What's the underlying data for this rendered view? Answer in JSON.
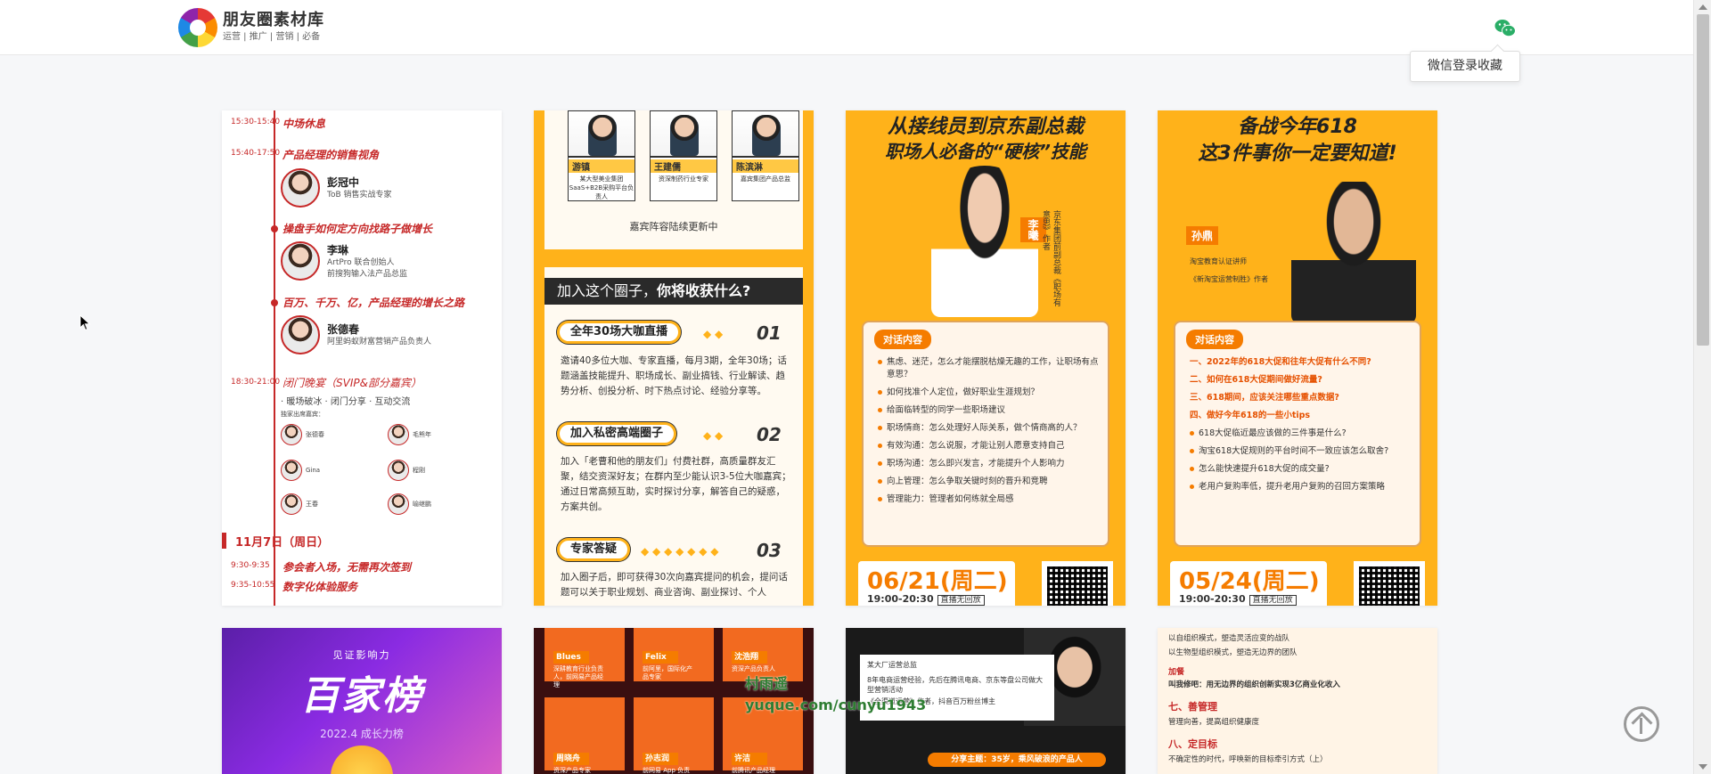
{
  "header": {
    "brand_title": "朋友圈素材库",
    "brand_sub": "运营 | 推广 | 营销 | 必备",
    "login_tip": "微信登录收藏"
  },
  "card1": {
    "items": [
      {
        "time": "15:30-15:40",
        "title": "中场休息"
      },
      {
        "time": "15:40-17:50",
        "title": "产品经理的销售视角"
      },
      {
        "time": "",
        "title": "操盘手如何定方向找路子做增长"
      },
      {
        "time": "",
        "title": "百万、千万、亿，产品经理的增长之路"
      },
      {
        "time": "18:30-21:00",
        "title": "闭门晚宴（SVIP&部分嘉宾）"
      }
    ],
    "speakers": [
      {
        "name": "彭冠中",
        "desc1": "ToB 销售实战专家",
        "desc2": ""
      },
      {
        "name": "李琳",
        "desc1": "ArtPro 联合创始人",
        "desc2": "前搜狗输入法产品总监"
      },
      {
        "name": "张德春",
        "desc1": "阿里蚂蚁财富营销产品负责人",
        "desc2": ""
      }
    ],
    "dinner_tags": "· 暖场破冰 · 闭门分享 · 互动交流",
    "guests_label": "独家出席嘉宾：",
    "mini": [
      {
        "name": "张德春"
      },
      {
        "name": "毛熊年"
      },
      {
        "name": "Gina"
      },
      {
        "name": "程刚"
      },
      {
        "name": "王春"
      },
      {
        "name": "喻继鹏"
      }
    ],
    "date": "11月7日（周日）",
    "items2": [
      {
        "time": "9:30-9:35",
        "title": "参会者入场，无需再次签到"
      },
      {
        "time": "9:35-10:55",
        "title": "数字化体验服务"
      }
    ]
  },
  "card2": {
    "heads": [
      {
        "name": "游镇",
        "desc": "某大型美业集团 SaaS+B2B采购平台负责人"
      },
      {
        "name": "王建儒",
        "desc": "资深制药行业专家"
      },
      {
        "name": "陈滨淋",
        "desc": "嘉宾集团产品总监"
      }
    ],
    "update": "嘉宾阵容陆续更新中",
    "banner_a": "加入这个圈子，",
    "banner_b": "你将收获什么?",
    "blocks": [
      {
        "pill": "全年30场大咖直播",
        "num": "01",
        "text": "邀请40多位大咖、专家直播，每月3期，全年30场；话题涵盖技能提升、职场成长、副业搞钱、行业解读、趋势分析、创投分析、时下热点讨论、经验分享等。"
      },
      {
        "pill": "加入私密高端圈子",
        "num": "02",
        "text": "加入「老曹和他的朋友们」付费社群，高质量群友汇聚，结交资深好友；在群内至少能认识3-5位大咖嘉宾；通过日常高频互助，实时探讨分享，解答自己的疑惑，方案共创。"
      },
      {
        "pill": "专家答疑",
        "num": "03",
        "text": "加入圈子后，即可获得30次向嘉宾提问的机会，提问话题可以关于职业规划、商业咨询、副业探讨、个人"
      }
    ]
  },
  "card3": {
    "title1": "从接线员到京东副总裁",
    "title2": "职场人必备的“硬核”技能",
    "name": "李曦",
    "vert": "京东集团前副总裁《职场有意思》作者",
    "box_title": "对话内容",
    "list": [
      "焦虑、迷茫，怎么才能摆脱枯燥无趣的工作，让职场有点意思？",
      "如何找准个人定位，做好职业生涯规划？",
      "给面临转型的同学一些职场建议",
      "职场情商：怎么处理好人际关系，做个情商高的人？",
      "有效沟通：怎么说服，才能让别人愿意支持自己",
      "职场沟通：怎么即兴发言，才能提升个人影响力",
      "向上管理：怎么争取关键时刻的晋升和竞聘",
      "管理能力：管理者如何练就全局感"
    ],
    "date": "06/21(周二)",
    "time": "19:00-20:30",
    "tag": "直播无回放"
  },
  "card4": {
    "title1": "备战今年618",
    "title2": "这3件事你一定要知道!",
    "name": "孙鼎",
    "intro1": "淘宝教育认证讲师",
    "intro2": "《新淘宝运营制胜》作者",
    "box_title": "对话内容",
    "list": [
      {
        "hl": true,
        "t": "一、2022年的618大促和往年大促有什么不同?"
      },
      {
        "hl": true,
        "t": "二、如何在618大促期间做好流量?"
      },
      {
        "hl": true,
        "t": "三、618期间，应该关注哪些重点数据?"
      },
      {
        "hl": true,
        "t": "四、做好今年618的一些小tips"
      },
      {
        "hl": false,
        "t": "618大促临近最应该做的三件事是什么?"
      },
      {
        "hl": false,
        "t": "淘宝618大促规则的平台时间不一致应该怎么取舍?"
      },
      {
        "hl": false,
        "t": "怎么能快速提升618大促的成交量?"
      },
      {
        "hl": false,
        "t": "老用户复购率低，提升老用户复购的召回方案策略"
      }
    ],
    "date": "05/24(周二)",
    "time": "19:00-20:30",
    "tag": "直播无回放"
  },
  "card5": {
    "small": "见证影响力",
    "big": "百家榜",
    "sub": "2022.4 成长力榜"
  },
  "card6": {
    "people": [
      {
        "name": "Blues",
        "desc": "深耕教育行业负责人，前网易产品经理"
      },
      {
        "name": "Felix",
        "desc": "前阿里，国际化产品专家"
      },
      {
        "name": "沈浩翔",
        "desc": "资深产品负责人"
      },
      {
        "name": "周晓舟",
        "desc": "资深产品专家"
      },
      {
        "name": "孙志润",
        "desc": "前网易 App 负责人"
      },
      {
        "name": "许洁",
        "desc": "前腾讯产品经理"
      }
    ]
  },
  "card7": {
    "org": "某大厂运营总监",
    "text1": "8年电商运营经验，先后在腾讯电商、京东等盘公司做大型营销活动",
    "text2": "《全渠道运营》作者，抖音百万粉丝博主",
    "bar": "分享主题：35岁，乘风破浪的产品人"
  },
  "card8": {
    "l1": "以自组织模式，塑造灵活应变的战队",
    "l2": "以生物型组织模式，塑造无边界的团队",
    "h1": "加餐",
    "l3": "叫我修吧：用无边界的组织创新实现3亿商业化收入",
    "h2": "七、善管理",
    "l4": "管理向善，提高组织健康度",
    "h3": "八、定目标",
    "l5": "不确定性的时代，呼唤新的目标牵引方式（上）"
  },
  "watermark": {
    "line1": "村雨遥",
    "line2": "yuque.com/cunyu1943"
  }
}
